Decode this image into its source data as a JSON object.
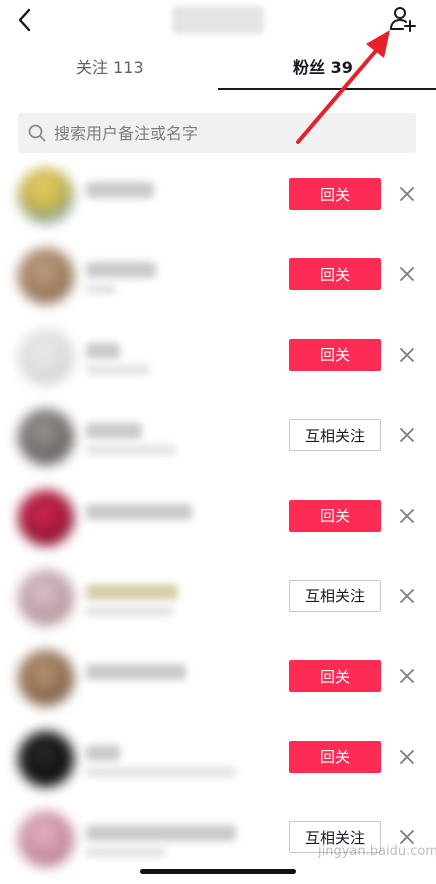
{
  "nav": {
    "back_icon": "chevron-left-icon",
    "add_user_icon": "add-user-icon"
  },
  "tabs": [
    {
      "label": "关注 113",
      "active": false
    },
    {
      "label": "粉丝 39",
      "active": true
    }
  ],
  "search": {
    "placeholder": "搜索用户备注或名字",
    "value": ""
  },
  "colors": {
    "accent": "#fe2c55",
    "annotation_arrow": "#e8202a",
    "text_primary": "#161823",
    "text_secondary": "#5f6066"
  },
  "fans": [
    {
      "avatar_color": "#c9b34a",
      "action_label": "回关",
      "action_type": "follow_back"
    },
    {
      "avatar_color": "#9a7b5c",
      "action_label": "回关",
      "action_type": "follow_back"
    },
    {
      "avatar_color": "#d8d8dc",
      "action_label": "回关",
      "action_type": "follow_back"
    },
    {
      "avatar_color": "#6f6a68",
      "action_label": "互相关注",
      "action_type": "mutual"
    },
    {
      "avatar_color": "#a3173a",
      "action_label": "回关",
      "action_type": "follow_back"
    },
    {
      "avatar_color": "#b99aa8",
      "action_label": "互相关注",
      "action_type": "mutual"
    },
    {
      "avatar_color": "#8c6b4e",
      "action_label": "回关",
      "action_type": "follow_back"
    },
    {
      "avatar_color": "#0f0f10",
      "action_label": "回关",
      "action_type": "follow_back"
    },
    {
      "avatar_color": "#c78aa0",
      "action_label": "互相关注",
      "action_type": "mutual"
    }
  ],
  "watermark": {
    "text": "jingyan.baidu.com"
  }
}
